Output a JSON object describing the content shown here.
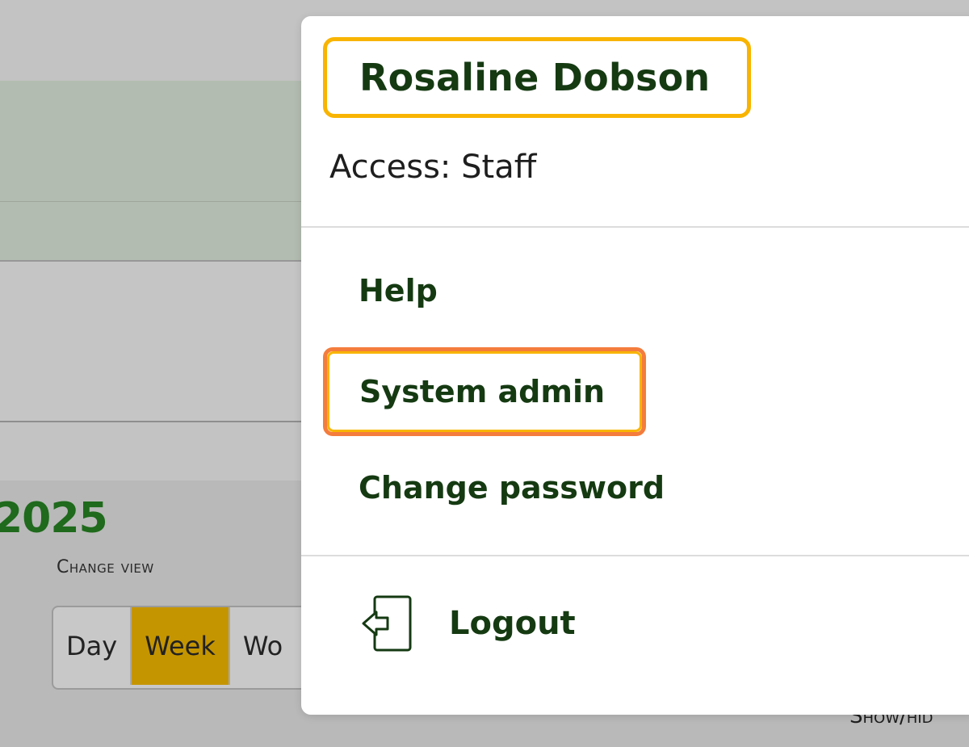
{
  "background": {
    "year_fragment": "2025",
    "change_view_label": "Change view",
    "view_buttons": [
      "Day",
      "Week",
      "Wo"
    ],
    "active_view": "Week",
    "show_hide_fragment": "Show/hid",
    "colors": {
      "active_view": "#c59500",
      "year": "#1f6a1c"
    }
  },
  "user_menu": {
    "user_name": "Rosaline Dobson",
    "access_text": "Access: Staff",
    "items": [
      {
        "label": "Help"
      },
      {
        "label": "System admin"
      },
      {
        "label": "Change password"
      }
    ],
    "logout_label": "Logout",
    "logout_icon": "logout-icon",
    "colors": {
      "text": "#153a12",
      "highlight_user": "#f8b400",
      "highlight_item": "#f47c3c"
    }
  }
}
